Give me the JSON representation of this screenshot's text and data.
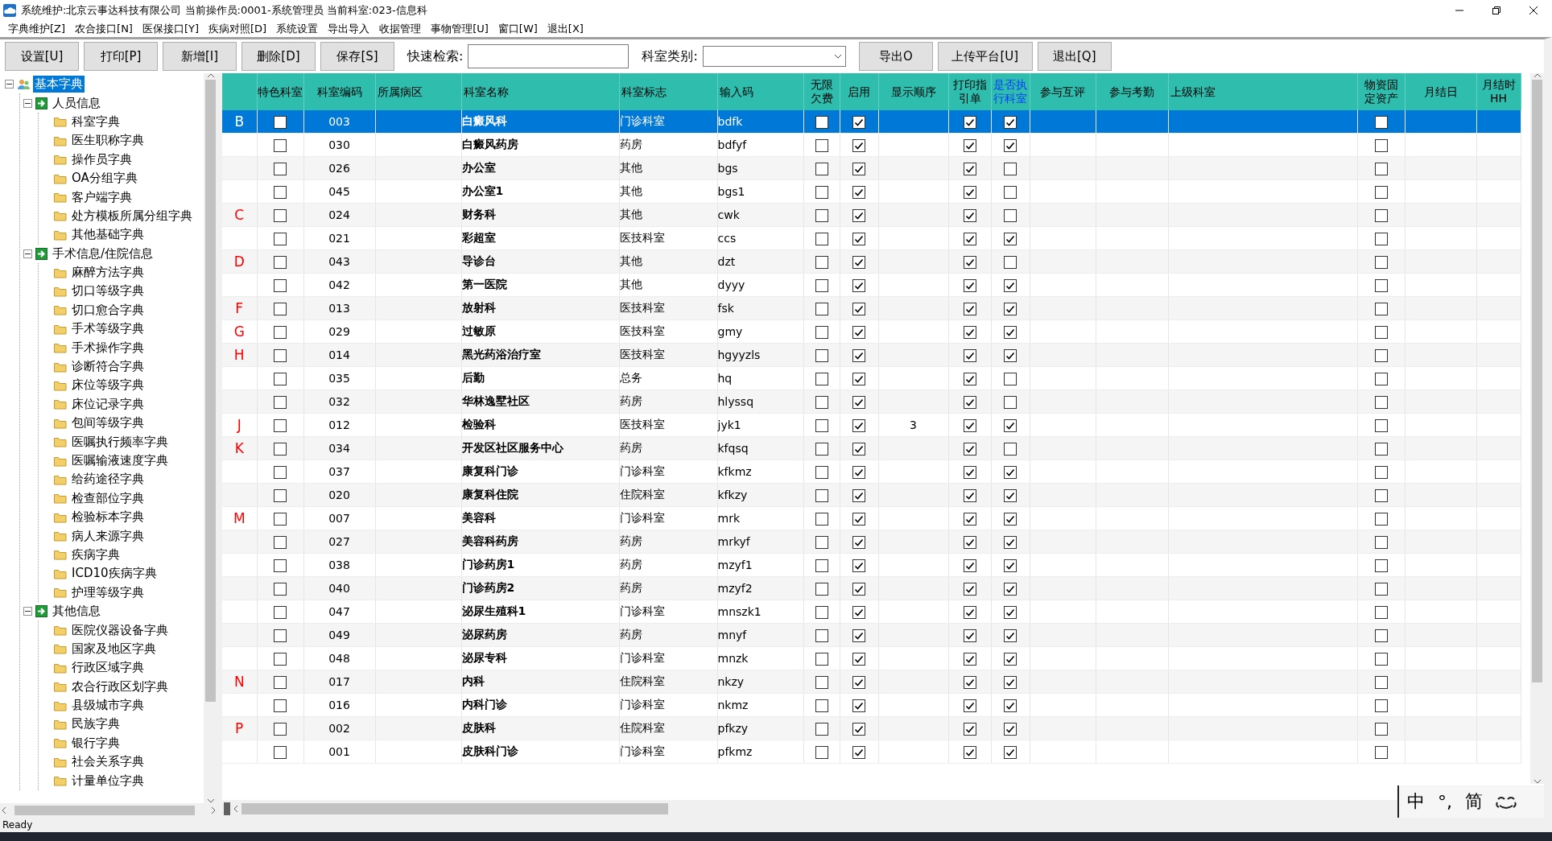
{
  "window": {
    "title": "系统维护:北京云事达科技有限公司 当前操作员:0001-系统管理员 当前科室:023-信息科"
  },
  "menu": [
    "字典维护[Z]",
    "农合接口[N]",
    "医保接口[Y]",
    "疾病对照[D]",
    "系统设置",
    "导出导入",
    "收据管理",
    "事物管理[U]",
    "窗口[W]",
    "退出[X]"
  ],
  "toolbar": {
    "buttons": [
      "设置[U]",
      "打印[P]",
      "新增[I]",
      "删除[D]",
      "保存[S]"
    ],
    "search": {
      "label": "快速检索:"
    },
    "category": {
      "label": "科室类别:"
    },
    "buttons_right": [
      "导出O",
      "上传平台[U]",
      "退出[Q]"
    ]
  },
  "sidebar": {
    "tree": [
      {
        "label": "基本字典",
        "kind": "root",
        "selected": true,
        "expanded": true,
        "children": [
          {
            "label": "人员信息",
            "kind": "group",
            "selected": false,
            "expanded": true,
            "children": [
              {
                "label": "科室字典",
                "kind": "folder",
                "selected": false
              },
              {
                "label": "医生职称字典",
                "kind": "folder",
                "selected": false
              },
              {
                "label": "操作员字典",
                "kind": "folder",
                "selected": false
              },
              {
                "label": "OA分组字典",
                "kind": "folder",
                "selected": false
              },
              {
                "label": "客户端字典",
                "kind": "folder",
                "selected": false
              },
              {
                "label": "处方模板所属分组字典",
                "kind": "folder",
                "selected": false
              },
              {
                "label": "其他基础字典",
                "kind": "folder",
                "selected": false
              }
            ]
          },
          {
            "label": "手术信息/住院信息",
            "kind": "group",
            "selected": false,
            "expanded": true,
            "children": [
              {
                "label": "麻醉方法字典",
                "kind": "folder",
                "selected": false
              },
              {
                "label": "切口等级字典",
                "kind": "folder",
                "selected": false
              },
              {
                "label": "切口愈合字典",
                "kind": "folder",
                "selected": false
              },
              {
                "label": "手术等级字典",
                "kind": "folder",
                "selected": false
              },
              {
                "label": "手术操作字典",
                "kind": "folder",
                "selected": false
              },
              {
                "label": "诊断符合字典",
                "kind": "folder",
                "selected": false
              },
              {
                "label": "床位等级字典",
                "kind": "folder",
                "selected": false
              },
              {
                "label": "床位记录字典",
                "kind": "folder",
                "selected": false
              },
              {
                "label": "包间等级字典",
                "kind": "folder",
                "selected": false
              },
              {
                "label": "医嘱执行频率字典",
                "kind": "folder",
                "selected": false
              },
              {
                "label": "医嘱输液速度字典",
                "kind": "folder",
                "selected": false
              },
              {
                "label": "给药途径字典",
                "kind": "folder",
                "selected": false
              },
              {
                "label": "检查部位字典",
                "kind": "folder",
                "selected": false
              },
              {
                "label": "检验标本字典",
                "kind": "folder",
                "selected": false
              },
              {
                "label": "病人来源字典",
                "kind": "folder",
                "selected": false
              },
              {
                "label": "疾病字典",
                "kind": "folder",
                "selected": false
              },
              {
                "label": "ICD10疾病字典",
                "kind": "folder",
                "selected": false
              },
              {
                "label": "护理等级字典",
                "kind": "folder",
                "selected": false
              }
            ]
          },
          {
            "label": "其他信息",
            "kind": "group",
            "selected": false,
            "expanded": true,
            "children": [
              {
                "label": "医院仪器设备字典",
                "kind": "folder",
                "selected": false
              },
              {
                "label": "国家及地区字典",
                "kind": "folder",
                "selected": false
              },
              {
                "label": "行政区域字典",
                "kind": "folder",
                "selected": false
              },
              {
                "label": "农合行政区划字典",
                "kind": "folder",
                "selected": false
              },
              {
                "label": "县级城市字典",
                "kind": "folder",
                "selected": false
              },
              {
                "label": "民族字典",
                "kind": "folder",
                "selected": false
              },
              {
                "label": "银行字典",
                "kind": "folder",
                "selected": false
              },
              {
                "label": "社会关系字典",
                "kind": "folder",
                "selected": false
              },
              {
                "label": "计量单位字典",
                "kind": "folder",
                "selected": false
              }
            ]
          }
        ]
      }
    ]
  },
  "table": {
    "columns": [
      {
        "label": "特色科室",
        "highlighted": false
      },
      {
        "label": "科室编码",
        "highlighted": false
      },
      {
        "label": "所属病区",
        "highlighted": false
      },
      {
        "label": "科室名称",
        "highlighted": false
      },
      {
        "label": "科室标志",
        "highlighted": false
      },
      {
        "label": "输入码",
        "highlighted": false
      },
      {
        "label": "无限欠费",
        "highlighted": false
      },
      {
        "label": "启用",
        "highlighted": false
      },
      {
        "label": "显示顺序",
        "highlighted": false
      },
      {
        "label": "打印指引单",
        "highlighted": false
      },
      {
        "label": "是否执行科室",
        "highlighted": true
      },
      {
        "label": "参与互评",
        "highlighted": false
      },
      {
        "label": "参与考勤",
        "highlighted": false
      },
      {
        "label": "上级科室",
        "highlighted": false
      },
      {
        "label": "物资固定资产",
        "highlighted": false
      },
      {
        "label": "月结日",
        "highlighted": false
      },
      {
        "label": "月结时HH",
        "highlighted": false
      }
    ],
    "rows": [
      {
        "letter": "B",
        "code": "003",
        "name": "白癜风科",
        "tag": "门诊科室",
        "input_code": "bdfk",
        "featured": false,
        "unlimited": false,
        "enabled": true,
        "print_guide": true,
        "executing": true,
        "fixed_asset": false,
        "selected": true
      },
      {
        "code": "030",
        "name": "白癜风药房",
        "tag": "药房",
        "input_code": "bdfyf",
        "featured": false,
        "unlimited": false,
        "enabled": true,
        "print_guide": true,
        "executing": true,
        "fixed_asset": false,
        "selected": false
      },
      {
        "code": "026",
        "name": "办公室",
        "tag": "其他",
        "input_code": "bgs",
        "featured": false,
        "unlimited": false,
        "enabled": true,
        "print_guide": true,
        "executing": false,
        "fixed_asset": false,
        "selected": false
      },
      {
        "code": "045",
        "name": "办公室1",
        "tag": "其他",
        "input_code": "bgs1",
        "featured": false,
        "unlimited": false,
        "enabled": true,
        "print_guide": true,
        "executing": false,
        "fixed_asset": false,
        "selected": false
      },
      {
        "letter": "C",
        "code": "024",
        "name": "财务科",
        "tag": "其他",
        "input_code": "cwk",
        "featured": false,
        "unlimited": false,
        "enabled": true,
        "print_guide": true,
        "executing": false,
        "fixed_asset": false,
        "selected": false
      },
      {
        "code": "021",
        "name": "彩超室",
        "tag": "医技科室",
        "input_code": "ccs",
        "featured": false,
        "unlimited": false,
        "enabled": true,
        "print_guide": true,
        "executing": true,
        "fixed_asset": false,
        "selected": false
      },
      {
        "letter": "D",
        "code": "043",
        "name": "导诊台",
        "tag": "其他",
        "input_code": "dzt",
        "featured": false,
        "unlimited": false,
        "enabled": true,
        "print_guide": true,
        "executing": false,
        "fixed_asset": false,
        "selected": false
      },
      {
        "code": "042",
        "name": "第一医院",
        "tag": "其他",
        "input_code": "dyyy",
        "featured": false,
        "unlimited": false,
        "enabled": true,
        "print_guide": true,
        "executing": true,
        "fixed_asset": false,
        "selected": false
      },
      {
        "letter": "F",
        "code": "013",
        "name": "放射科",
        "tag": "医技科室",
        "input_code": "fsk",
        "featured": false,
        "unlimited": false,
        "enabled": true,
        "print_guide": true,
        "executing": true,
        "fixed_asset": false,
        "selected": false
      },
      {
        "letter": "G",
        "code": "029",
        "name": "过敏原",
        "tag": "医技科室",
        "input_code": "gmy",
        "featured": false,
        "unlimited": false,
        "enabled": true,
        "print_guide": true,
        "executing": true,
        "fixed_asset": false,
        "selected": false
      },
      {
        "letter": "H",
        "code": "014",
        "name": "黑光药浴治疗室",
        "tag": "医技科室",
        "input_code": "hgyyzls",
        "featured": false,
        "unlimited": false,
        "enabled": true,
        "print_guide": true,
        "executing": true,
        "fixed_asset": false,
        "selected": false
      },
      {
        "code": "035",
        "name": "后勤",
        "tag": "总务",
        "input_code": "hq",
        "featured": false,
        "unlimited": false,
        "enabled": true,
        "print_guide": true,
        "executing": false,
        "fixed_asset": false,
        "selected": false
      },
      {
        "code": "032",
        "name": "华林逸墅社区",
        "tag": "药房",
        "input_code": "hlyssq",
        "featured": false,
        "unlimited": false,
        "enabled": true,
        "print_guide": true,
        "executing": false,
        "fixed_asset": false,
        "selected": false
      },
      {
        "letter": "J",
        "code": "012",
        "name": "检验科",
        "tag": "医技科室",
        "input_code": "jyk1",
        "order": "3",
        "featured": false,
        "unlimited": false,
        "enabled": true,
        "print_guide": true,
        "executing": true,
        "fixed_asset": false,
        "selected": false
      },
      {
        "letter": "K",
        "code": "034",
        "name": "开发区社区服务中心",
        "tag": "药房",
        "input_code": "kfqsq",
        "featured": false,
        "unlimited": false,
        "enabled": true,
        "print_guide": true,
        "executing": false,
        "fixed_asset": false,
        "selected": false
      },
      {
        "code": "037",
        "name": "康复科门诊",
        "tag": "门诊科室",
        "input_code": "kfkmz",
        "featured": false,
        "unlimited": false,
        "enabled": true,
        "print_guide": true,
        "executing": true,
        "fixed_asset": false,
        "selected": false
      },
      {
        "code": "020",
        "name": "康复科住院",
        "tag": "住院科室",
        "input_code": "kfkzy",
        "featured": false,
        "unlimited": false,
        "enabled": true,
        "print_guide": true,
        "executing": true,
        "fixed_asset": false,
        "selected": false
      },
      {
        "letter": "M",
        "code": "007",
        "name": "美容科",
        "tag": "门诊科室",
        "input_code": "mrk",
        "featured": false,
        "unlimited": false,
        "enabled": true,
        "print_guide": true,
        "executing": true,
        "fixed_asset": false,
        "selected": false
      },
      {
        "code": "027",
        "name": "美容科药房",
        "tag": "药房",
        "input_code": "mrkyf",
        "featured": false,
        "unlimited": false,
        "enabled": true,
        "print_guide": true,
        "executing": true,
        "fixed_asset": false,
        "selected": false
      },
      {
        "code": "038",
        "name": "门诊药房1",
        "tag": "药房",
        "input_code": "mzyf1",
        "featured": false,
        "unlimited": false,
        "enabled": true,
        "print_guide": true,
        "executing": true,
        "fixed_asset": false,
        "selected": false
      },
      {
        "code": "040",
        "name": "门诊药房2",
        "tag": "药房",
        "input_code": "mzyf2",
        "featured": false,
        "unlimited": false,
        "enabled": true,
        "print_guide": true,
        "executing": true,
        "fixed_asset": false,
        "selected": false
      },
      {
        "code": "047",
        "name": "泌尿生殖科1",
        "tag": "门诊科室",
        "input_code": "mnszk1",
        "featured": false,
        "unlimited": false,
        "enabled": true,
        "print_guide": true,
        "executing": true,
        "fixed_asset": false,
        "selected": false
      },
      {
        "code": "049",
        "name": "泌尿药房",
        "tag": "药房",
        "input_code": "mnyf",
        "featured": false,
        "unlimited": false,
        "enabled": true,
        "print_guide": true,
        "executing": true,
        "fixed_asset": false,
        "selected": false
      },
      {
        "code": "048",
        "name": "泌尿专科",
        "tag": "门诊科室",
        "input_code": "mnzk",
        "featured": false,
        "unlimited": false,
        "enabled": true,
        "print_guide": true,
        "executing": true,
        "fixed_asset": false,
        "selected": false
      },
      {
        "letter": "N",
        "code": "017",
        "name": "内科",
        "tag": "住院科室",
        "input_code": "nkzy",
        "featured": false,
        "unlimited": false,
        "enabled": true,
        "print_guide": true,
        "executing": true,
        "fixed_asset": false,
        "selected": false
      },
      {
        "code": "016",
        "name": "内科门诊",
        "tag": "门诊科室",
        "input_code": "nkmz",
        "featured": false,
        "unlimited": false,
        "enabled": true,
        "print_guide": true,
        "executing": true,
        "fixed_asset": false,
        "selected": false
      },
      {
        "letter": "P",
        "code": "002",
        "name": "皮肤科",
        "tag": "住院科室",
        "input_code": "pfkzy",
        "featured": false,
        "unlimited": false,
        "enabled": true,
        "print_guide": true,
        "executing": true,
        "fixed_asset": false,
        "selected": false
      },
      {
        "code": "001",
        "name": "皮肤科门诊",
        "tag": "门诊科室",
        "input_code": "pfkmz",
        "featured": false,
        "unlimited": false,
        "enabled": true,
        "print_guide": true,
        "executing": true,
        "fixed_asset": false,
        "selected": false
      }
    ]
  },
  "ime_bar": [
    "中",
    "°,",
    "简"
  ],
  "status_bar": "Ready"
}
